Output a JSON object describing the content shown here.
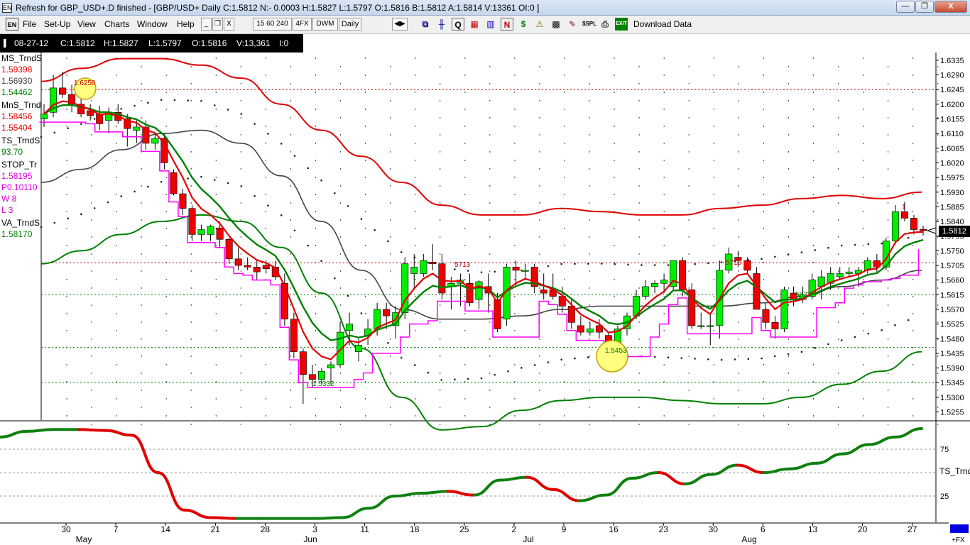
{
  "window": {
    "title": "Refresh for GBP_USD+.D finished - [GBP/USD+ Daily C:1.5812 N:- 0.0003 H:1.5827 L:1.5797 O:1.5816 B:1.5812 A:1.5814 V:13361 OI:0 ]",
    "app_icon": "EN",
    "minimize": "—",
    "restore": "❐",
    "close": "X"
  },
  "menu": {
    "items": [
      "File",
      "Set-Up",
      "View",
      "Charts",
      "Window",
      "Help"
    ],
    "mdi_controls": [
      "_",
      "❐",
      "X"
    ],
    "timeframes": [
      "15 60 240",
      "4FX",
      "DWM",
      "Daily"
    ],
    "download_label": "Download Data"
  },
  "infobar": {
    "date": "08-27-12",
    "close": "C:1.5812",
    "high": "H:1.5827",
    "low": "L:1.5797",
    "open": "O:1.5816",
    "volume": "V:13,361",
    "oi": "I:0"
  },
  "indicators": [
    {
      "name": "MS_TrndS",
      "values": [
        {
          "v": "1.59398",
          "color": "#e00000"
        },
        {
          "v": "1.56930",
          "color": "#444444"
        },
        {
          "v": "1.54462",
          "color": "#008000"
        }
      ]
    },
    {
      "name": "MnS_Trnd",
      "values": [
        {
          "v": "1.58456",
          "color": "#e00000"
        },
        {
          "v": "1.55404",
          "color": "#e00000"
        }
      ]
    },
    {
      "name": "TS_TrndS",
      "values": [
        {
          "v": "93.70",
          "color": "#008000"
        }
      ]
    },
    {
      "name": "STOP_Tr",
      "values": [
        {
          "v": "1.58195",
          "color": "#e000e0"
        },
        {
          "v": "P0.10110",
          "color": "#e000e0"
        },
        {
          "v": "W 8",
          "color": "#e000e0"
        },
        {
          "v": "L 3",
          "color": "#e000e0"
        }
      ]
    },
    {
      "name": "VA_TrndS",
      "values": [
        {
          "v": "1.58170",
          "color": "#008000"
        }
      ]
    }
  ],
  "price_axis": [
    "1.6335",
    "1.6290",
    "1.6245",
    "1.6200",
    "1.6155",
    "1.6110",
    "1.6065",
    "1.6020",
    "1.5975",
    "1.5930",
    "1.5885",
    "1.5840",
    "1.5795",
    "1.5750",
    "1.5705",
    "1.5660",
    "1.5615",
    "1.5570",
    "1.5525",
    "1.5480",
    "1.5435",
    "1.5390",
    "1.5345",
    "1.5300",
    "1.5255"
  ],
  "last_price_tag": "1.5812",
  "ts_axis": {
    "labels": [
      "75",
      "25"
    ],
    "name": "TS_Trnd"
  },
  "date_axis": {
    "days": [
      "30",
      "7",
      "14",
      "21",
      "28",
      "3",
      "11",
      "18",
      "25",
      "2",
      "9",
      "16",
      "23",
      "30",
      "6",
      "13",
      "20",
      "27"
    ],
    "months": [
      "May",
      "Jun",
      "Jul",
      "Aug"
    ],
    "fx_label": "+FX"
  },
  "chart_annotations": {
    "high_circle_label": "1.6250",
    "low_circle_label": "1.5453",
    "june_low_label": "1.5332",
    "level_label_1": "5713",
    "level_label_2": "5716",
    "level_label_3": "5623",
    "last_bar_marker": "1"
  },
  "colors": {
    "up_candle": "#00ee00",
    "down_candle": "#ee0000",
    "band_red": "#e00000",
    "band_green": "#008000",
    "midline": "#444444",
    "stop_line": "#ff00ff",
    "highlight_circle": "#ffff80"
  },
  "chart_data": {
    "type": "candlestick",
    "symbol": "GBP/USD+ Daily",
    "ylim": [
      1.523,
      1.635
    ],
    "candles": [
      {
        "o": 1.6155,
        "h": 1.62,
        "l": 1.613,
        "c": 1.617
      },
      {
        "o": 1.6175,
        "h": 1.629,
        "l": 1.616,
        "c": 1.625
      },
      {
        "o": 1.625,
        "h": 1.63,
        "l": 1.622,
        "c": 1.623
      },
      {
        "o": 1.623,
        "h": 1.626,
        "l": 1.6175,
        "c": 1.62
      },
      {
        "o": 1.62,
        "h": 1.624,
        "l": 1.616,
        "c": 1.617
      },
      {
        "o": 1.618,
        "h": 1.62,
        "l": 1.615,
        "c": 1.6165
      },
      {
        "o": 1.617,
        "h": 1.6195,
        "l": 1.612,
        "c": 1.614
      },
      {
        "o": 1.615,
        "h": 1.619,
        "l": 1.611,
        "c": 1.6175
      },
      {
        "o": 1.6175,
        "h": 1.62,
        "l": 1.614,
        "c": 1.615
      },
      {
        "o": 1.6155,
        "h": 1.617,
        "l": 1.607,
        "c": 1.6125
      },
      {
        "o": 1.612,
        "h": 1.615,
        "l": 1.608,
        "c": 1.613
      },
      {
        "o": 1.613,
        "h": 1.615,
        "l": 1.606,
        "c": 1.608
      },
      {
        "o": 1.608,
        "h": 1.611,
        "l": 1.606,
        "c": 1.6095
      },
      {
        "o": 1.6095,
        "h": 1.611,
        "l": 1.6,
        "c": 1.602
      },
      {
        "o": 1.599,
        "h": 1.6,
        "l": 1.592,
        "c": 1.5925
      },
      {
        "o": 1.5925,
        "h": 1.594,
        "l": 1.586,
        "c": 1.588
      },
      {
        "o": 1.588,
        "h": 1.589,
        "l": 1.578,
        "c": 1.58
      },
      {
        "o": 1.58,
        "h": 1.583,
        "l": 1.578,
        "c": 1.5815
      },
      {
        "o": 1.58,
        "h": 1.583,
        "l": 1.578,
        "c": 1.5825
      },
      {
        "o": 1.582,
        "h": 1.584,
        "l": 1.576,
        "c": 1.5785
      },
      {
        "o": 1.5785,
        "h": 1.579,
        "l": 1.571,
        "c": 1.5725
      },
      {
        "o": 1.5725,
        "h": 1.576,
        "l": 1.569,
        "c": 1.5705
      },
      {
        "o": 1.5705,
        "h": 1.573,
        "l": 1.569,
        "c": 1.57
      },
      {
        "o": 1.57,
        "h": 1.572,
        "l": 1.566,
        "c": 1.5685
      },
      {
        "o": 1.5705,
        "h": 1.572,
        "l": 1.568,
        "c": 1.5695
      },
      {
        "o": 1.57,
        "h": 1.572,
        "l": 1.566,
        "c": 1.567
      },
      {
        "o": 1.565,
        "h": 1.568,
        "l": 1.552,
        "c": 1.554
      },
      {
        "o": 1.554,
        "h": 1.556,
        "l": 1.542,
        "c": 1.544
      },
      {
        "o": 1.544,
        "h": 1.545,
        "l": 1.528,
        "c": 1.537
      },
      {
        "o": 1.537,
        "h": 1.54,
        "l": 1.533,
        "c": 1.5355
      },
      {
        "o": 1.5355,
        "h": 1.539,
        "l": 1.534,
        "c": 1.538
      },
      {
        "o": 1.539,
        "h": 1.541,
        "l": 1.534,
        "c": 1.54
      },
      {
        "o": 1.54,
        "h": 1.553,
        "l": 1.539,
        "c": 1.55
      },
      {
        "o": 1.5505,
        "h": 1.556,
        "l": 1.546,
        "c": 1.5525
      },
      {
        "o": 1.544,
        "h": 1.548,
        "l": 1.541,
        "c": 1.546
      },
      {
        "o": 1.549,
        "h": 1.554,
        "l": 1.546,
        "c": 1.551
      },
      {
        "o": 1.551,
        "h": 1.559,
        "l": 1.549,
        "c": 1.557
      },
      {
        "o": 1.557,
        "h": 1.559,
        "l": 1.551,
        "c": 1.555
      },
      {
        "o": 1.552,
        "h": 1.558,
        "l": 1.548,
        "c": 1.556
      },
      {
        "o": 1.556,
        "h": 1.573,
        "l": 1.554,
        "c": 1.571
      },
      {
        "o": 1.568,
        "h": 1.574,
        "l": 1.563,
        "c": 1.57
      },
      {
        "o": 1.568,
        "h": 1.574,
        "l": 1.567,
        "c": 1.572
      },
      {
        "o": 1.5715,
        "h": 1.577,
        "l": 1.569,
        "c": 1.571
      },
      {
        "o": 1.571,
        "h": 1.574,
        "l": 1.56,
        "c": 1.562
      },
      {
        "o": 1.564,
        "h": 1.567,
        "l": 1.557,
        "c": 1.565
      },
      {
        "o": 1.565,
        "h": 1.568,
        "l": 1.558,
        "c": 1.566
      },
      {
        "o": 1.565,
        "h": 1.568,
        "l": 1.558,
        "c": 1.559
      },
      {
        "o": 1.56,
        "h": 1.566,
        "l": 1.557,
        "c": 1.5655
      },
      {
        "o": 1.564,
        "h": 1.568,
        "l": 1.556,
        "c": 1.562
      },
      {
        "o": 1.56,
        "h": 1.562,
        "l": 1.55,
        "c": 1.551
      },
      {
        "o": 1.554,
        "h": 1.571,
        "l": 1.552,
        "c": 1.57
      },
      {
        "o": 1.57,
        "h": 1.572,
        "l": 1.564,
        "c": 1.569
      },
      {
        "o": 1.569,
        "h": 1.571,
        "l": 1.566,
        "c": 1.569
      },
      {
        "o": 1.57,
        "h": 1.571,
        "l": 1.562,
        "c": 1.564
      },
      {
        "o": 1.563,
        "h": 1.568,
        "l": 1.56,
        "c": 1.562
      },
      {
        "o": 1.563,
        "h": 1.568,
        "l": 1.56,
        "c": 1.561
      },
      {
        "o": 1.561,
        "h": 1.564,
        "l": 1.556,
        "c": 1.558
      },
      {
        "o": 1.558,
        "h": 1.56,
        "l": 1.551,
        "c": 1.553
      },
      {
        "o": 1.552,
        "h": 1.555,
        "l": 1.549,
        "c": 1.55
      },
      {
        "o": 1.55,
        "h": 1.553,
        "l": 1.549,
        "c": 1.551
      },
      {
        "o": 1.552,
        "h": 1.554,
        "l": 1.548,
        "c": 1.55
      },
      {
        "o": 1.549,
        "h": 1.55,
        "l": 1.54,
        "c": 1.545
      },
      {
        "o": 1.546,
        "h": 1.552,
        "l": 1.545,
        "c": 1.551
      },
      {
        "o": 1.551,
        "h": 1.556,
        "l": 1.549,
        "c": 1.555
      },
      {
        "o": 1.555,
        "h": 1.563,
        "l": 1.554,
        "c": 1.561
      },
      {
        "o": 1.561,
        "h": 1.566,
        "l": 1.56,
        "c": 1.564
      },
      {
        "o": 1.564,
        "h": 1.566,
        "l": 1.562,
        "c": 1.565
      },
      {
        "o": 1.565,
        "h": 1.568,
        "l": 1.562,
        "c": 1.566
      },
      {
        "o": 1.564,
        "h": 1.572,
        "l": 1.563,
        "c": 1.572
      },
      {
        "o": 1.572,
        "h": 1.573,
        "l": 1.561,
        "c": 1.563
      },
      {
        "o": 1.563,
        "h": 1.565,
        "l": 1.551,
        "c": 1.552
      },
      {
        "o": 1.552,
        "h": 1.556,
        "l": 1.551,
        "c": 1.552
      },
      {
        "o": 1.552,
        "h": 1.556,
        "l": 1.546,
        "c": 1.552
      },
      {
        "o": 1.552,
        "h": 1.572,
        "l": 1.548,
        "c": 1.569
      },
      {
        "o": 1.569,
        "h": 1.576,
        "l": 1.568,
        "c": 1.574
      },
      {
        "o": 1.573,
        "h": 1.575,
        "l": 1.57,
        "c": 1.572
      },
      {
        "o": 1.572,
        "h": 1.573,
        "l": 1.568,
        "c": 1.569
      },
      {
        "o": 1.568,
        "h": 1.57,
        "l": 1.56,
        "c": 1.557
      },
      {
        "o": 1.557,
        "h": 1.559,
        "l": 1.551,
        "c": 1.553
      },
      {
        "o": 1.553,
        "h": 1.555,
        "l": 1.548,
        "c": 1.551
      },
      {
        "o": 1.551,
        "h": 1.564,
        "l": 1.55,
        "c": 1.563
      },
      {
        "o": 1.562,
        "h": 1.564,
        "l": 1.558,
        "c": 1.56
      },
      {
        "o": 1.56,
        "h": 1.564,
        "l": 1.559,
        "c": 1.5615
      },
      {
        "o": 1.561,
        "h": 1.568,
        "l": 1.56,
        "c": 1.566
      },
      {
        "o": 1.564,
        "h": 1.569,
        "l": 1.56,
        "c": 1.567
      },
      {
        "o": 1.565,
        "h": 1.57,
        "l": 1.563,
        "c": 1.568
      },
      {
        "o": 1.567,
        "h": 1.57,
        "l": 1.566,
        "c": 1.568
      },
      {
        "o": 1.568,
        "h": 1.57,
        "l": 1.567,
        "c": 1.5685
      },
      {
        "o": 1.568,
        "h": 1.57,
        "l": 1.564,
        "c": 1.569
      },
      {
        "o": 1.569,
        "h": 1.573,
        "l": 1.568,
        "c": 1.572
      },
      {
        "o": 1.572,
        "h": 1.574,
        "l": 1.568,
        "c": 1.57
      },
      {
        "o": 1.57,
        "h": 1.579,
        "l": 1.569,
        "c": 1.578
      },
      {
        "o": 1.578,
        "h": 1.589,
        "l": 1.577,
        "c": 1.587
      },
      {
        "o": 1.587,
        "h": 1.59,
        "l": 1.584,
        "c": 1.585
      },
      {
        "o": 1.585,
        "h": 1.586,
        "l": 1.58,
        "c": 1.5815
      },
      {
        "o": 1.5816,
        "h": 1.5827,
        "l": 1.5797,
        "c": 1.5812
      }
    ],
    "upper_band": [
      1.627,
      1.631,
      1.634,
      1.634,
      1.632,
      1.628,
      1.62,
      1.612,
      1.604,
      1.596,
      1.589,
      1.586,
      1.586,
      1.588,
      1.587,
      1.586,
      1.586,
      1.588,
      1.589,
      1.591,
      1.592,
      1.591,
      1.593
    ],
    "lower_band": [
      1.571,
      1.575,
      1.58,
      1.584,
      1.586,
      1.584,
      1.576,
      1.562,
      1.545,
      1.53,
      1.52,
      1.521,
      1.526,
      1.529,
      1.53,
      1.53,
      1.529,
      1.528,
      1.528,
      1.53,
      1.534,
      1.538,
      1.544
    ],
    "midline": [
      1.596,
      1.6,
      1.606,
      1.611,
      1.612,
      1.608,
      1.598,
      1.584,
      1.569,
      1.557,
      1.554,
      1.554,
      1.555,
      1.557,
      1.558,
      1.558,
      1.558,
      1.558,
      1.559,
      1.561,
      1.564,
      1.566,
      1.569
    ],
    "ts_oscillator": [
      88,
      94,
      96,
      96,
      95,
      90,
      50,
      10,
      2,
      1,
      1,
      1,
      1,
      2,
      12,
      25,
      28,
      30,
      26,
      42,
      45,
      32,
      20,
      26,
      44,
      50,
      38,
      48,
      58,
      50,
      54,
      60,
      70,
      80,
      88,
      97
    ]
  }
}
